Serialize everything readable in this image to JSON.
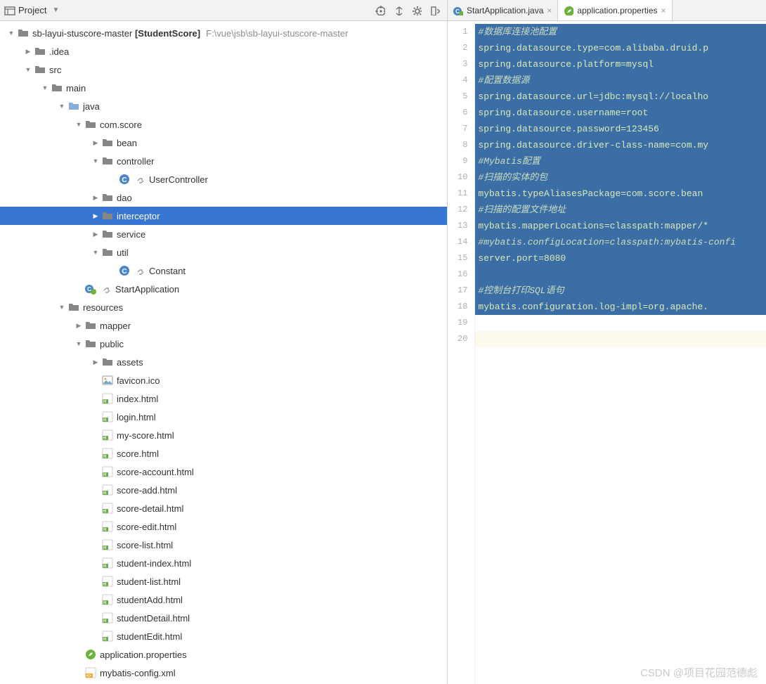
{
  "project_panel": {
    "title": "Project",
    "toolbar_icons": [
      "target-icon",
      "collapse-icon",
      "gear-icon",
      "hide-icon"
    ]
  },
  "tree": [
    {
      "depth": 0,
      "arrow": "down",
      "icon": "folder-grey",
      "label": "sb-layui-stuscore-master",
      "bold_suffix": " [StudentScore]",
      "extra": "F:\\vue\\jsb\\sb-layui-stuscore-master",
      "name": "project-root"
    },
    {
      "depth": 1,
      "arrow": "right",
      "icon": "folder-grey",
      "label": ".idea",
      "name": "folder-idea"
    },
    {
      "depth": 1,
      "arrow": "down",
      "icon": "folder-grey",
      "label": "src",
      "name": "folder-src"
    },
    {
      "depth": 2,
      "arrow": "down",
      "icon": "folder-grey",
      "label": "main",
      "name": "folder-main"
    },
    {
      "depth": 3,
      "arrow": "down",
      "icon": "folder-open",
      "label": "java",
      "name": "folder-java"
    },
    {
      "depth": 4,
      "arrow": "down",
      "icon": "folder-grey",
      "label": "com.score",
      "name": "package-com-score"
    },
    {
      "depth": 5,
      "arrow": "right",
      "icon": "folder-grey",
      "label": "bean",
      "name": "package-bean"
    },
    {
      "depth": 5,
      "arrow": "down",
      "icon": "folder-grey",
      "label": "controller",
      "name": "package-controller"
    },
    {
      "depth": 6,
      "arrow": "none",
      "icon": "class",
      "label": "UserController",
      "decor": "link",
      "name": "class-usercontroller"
    },
    {
      "depth": 5,
      "arrow": "right",
      "icon": "folder-grey",
      "label": "dao",
      "name": "package-dao"
    },
    {
      "depth": 5,
      "arrow": "right",
      "icon": "folder-grey",
      "label": "interceptor",
      "name": "package-interceptor",
      "selected": true
    },
    {
      "depth": 5,
      "arrow": "right",
      "icon": "folder-grey",
      "label": "service",
      "name": "package-service"
    },
    {
      "depth": 5,
      "arrow": "down",
      "icon": "folder-grey",
      "label": "util",
      "name": "package-util"
    },
    {
      "depth": 6,
      "arrow": "none",
      "icon": "class",
      "label": "Constant",
      "decor": "link",
      "name": "class-constant"
    },
    {
      "depth": 4,
      "arrow": "none",
      "icon": "spring-class",
      "label": "StartApplication",
      "decor": "link",
      "name": "class-startapplication"
    },
    {
      "depth": 3,
      "arrow": "down",
      "icon": "folder-grey",
      "label": "resources",
      "name": "folder-resources"
    },
    {
      "depth": 4,
      "arrow": "right",
      "icon": "folder-grey",
      "label": "mapper",
      "name": "folder-mapper"
    },
    {
      "depth": 4,
      "arrow": "down",
      "icon": "folder-grey",
      "label": "public",
      "name": "folder-public"
    },
    {
      "depth": 5,
      "arrow": "right",
      "icon": "folder-grey",
      "label": "assets",
      "name": "folder-assets"
    },
    {
      "depth": 5,
      "arrow": "none",
      "icon": "image",
      "label": "favicon.ico",
      "name": "file-favicon"
    },
    {
      "depth": 5,
      "arrow": "none",
      "icon": "html",
      "label": "index.html",
      "name": "file-index"
    },
    {
      "depth": 5,
      "arrow": "none",
      "icon": "html",
      "label": "login.html",
      "name": "file-login"
    },
    {
      "depth": 5,
      "arrow": "none",
      "icon": "html",
      "label": "my-score.html",
      "name": "file-my-score"
    },
    {
      "depth": 5,
      "arrow": "none",
      "icon": "html",
      "label": "score.html",
      "name": "file-score"
    },
    {
      "depth": 5,
      "arrow": "none",
      "icon": "html",
      "label": "score-account.html",
      "name": "file-score-account"
    },
    {
      "depth": 5,
      "arrow": "none",
      "icon": "html",
      "label": "score-add.html",
      "name": "file-score-add"
    },
    {
      "depth": 5,
      "arrow": "none",
      "icon": "html",
      "label": "score-detail.html",
      "name": "file-score-detail"
    },
    {
      "depth": 5,
      "arrow": "none",
      "icon": "html",
      "label": "score-edit.html",
      "name": "file-score-edit"
    },
    {
      "depth": 5,
      "arrow": "none",
      "icon": "html",
      "label": "score-list.html",
      "name": "file-score-list"
    },
    {
      "depth": 5,
      "arrow": "none",
      "icon": "html",
      "label": "student-index.html",
      "name": "file-student-index"
    },
    {
      "depth": 5,
      "arrow": "none",
      "icon": "html",
      "label": "student-list.html",
      "name": "file-student-list"
    },
    {
      "depth": 5,
      "arrow": "none",
      "icon": "html",
      "label": "studentAdd.html",
      "name": "file-studentadd"
    },
    {
      "depth": 5,
      "arrow": "none",
      "icon": "html",
      "label": "studentDetail.html",
      "name": "file-studentdetail"
    },
    {
      "depth": 5,
      "arrow": "none",
      "icon": "html",
      "label": "studentEdit.html",
      "name": "file-studentedit"
    },
    {
      "depth": 4,
      "arrow": "none",
      "icon": "spring",
      "label": "application.properties",
      "name": "file-application-properties"
    },
    {
      "depth": 4,
      "arrow": "none",
      "icon": "xml",
      "label": "mybatis-config.xml",
      "name": "file-mybatis-config"
    }
  ],
  "tabs": [
    {
      "icon": "spring-class",
      "label": "StartApplication.java",
      "active": false,
      "name": "tab-startapplication"
    },
    {
      "icon": "spring",
      "label": "application.properties",
      "active": true,
      "name": "tab-application-properties"
    }
  ],
  "editor": {
    "lines": [
      {
        "n": 1,
        "sel": true,
        "text": "#数据库连接池配置",
        "comment": true,
        "italic": true
      },
      {
        "n": 2,
        "sel": true,
        "text": "spring.datasource.type=com.alibaba.druid.p"
      },
      {
        "n": 3,
        "sel": true,
        "text": "spring.datasource.platform=mysql"
      },
      {
        "n": 4,
        "sel": true,
        "text": "#配置数据源",
        "comment": true,
        "italic": true
      },
      {
        "n": 5,
        "sel": true,
        "text": "spring.datasource.url=jdbc:mysql://localho"
      },
      {
        "n": 6,
        "sel": true,
        "text": "spring.datasource.username=root"
      },
      {
        "n": 7,
        "sel": true,
        "text": "spring.datasource.password=123456"
      },
      {
        "n": 8,
        "sel": true,
        "text": "spring.datasource.driver-class-name=com.my"
      },
      {
        "n": 9,
        "sel": true,
        "text": "#Mybatis配置",
        "comment": true,
        "italic": true
      },
      {
        "n": 10,
        "sel": true,
        "text": "#扫描的实体的包",
        "comment": true
      },
      {
        "n": 11,
        "sel": true,
        "text": "mybatis.typeAliasesPackage=com.score.bean"
      },
      {
        "n": 12,
        "sel": true,
        "text": "#扫描的配置文件地址",
        "comment": true
      },
      {
        "n": 13,
        "sel": true,
        "text": "mybatis.mapperLocations=classpath:mapper/*"
      },
      {
        "n": 14,
        "sel": true,
        "text": "#mybatis.configLocation=classpath:mybatis-confi",
        "comment": true,
        "italic": true
      },
      {
        "n": 15,
        "sel": true,
        "text": "server.port=8080"
      },
      {
        "n": 16,
        "sel": true,
        "text": ""
      },
      {
        "n": 17,
        "sel": true,
        "text": "#控制台打印SQL语句",
        "comment": true,
        "italic": true
      },
      {
        "n": 18,
        "sel": true,
        "text": "mybatis.configuration.log-impl=org.apache."
      },
      {
        "n": 19,
        "sel": false,
        "text": ""
      },
      {
        "n": 20,
        "sel": false,
        "text": "",
        "caret": true
      }
    ]
  },
  "watermark": "CSDN @项目花园范德彪"
}
